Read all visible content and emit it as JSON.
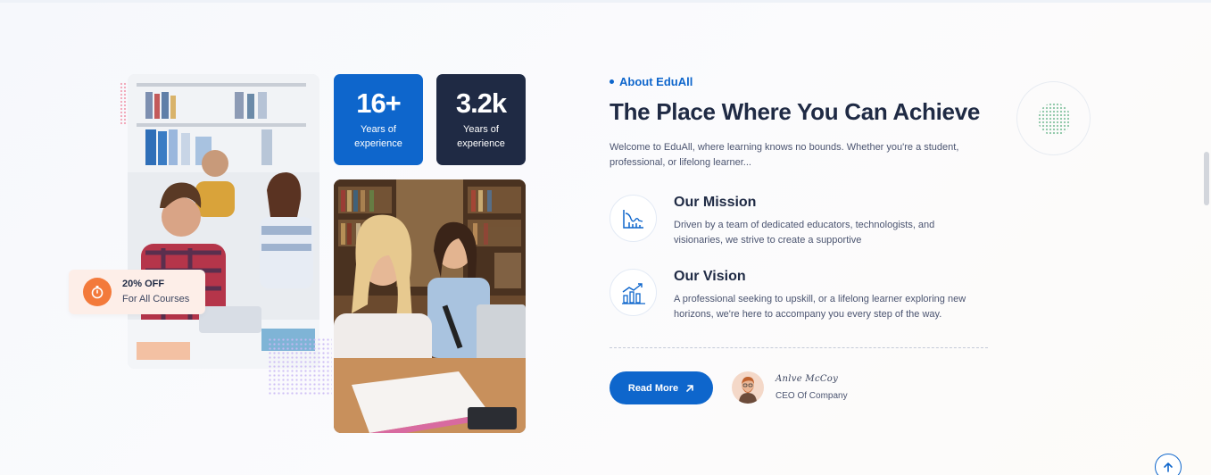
{
  "stats": [
    {
      "value": "16+",
      "label": "Years of experience"
    },
    {
      "value": "3.2k",
      "label": "Years of experience"
    }
  ],
  "promo": {
    "title": "20% OFF",
    "subtitle": "For All Courses",
    "icon": "stopwatch-icon"
  },
  "about": {
    "eyebrow": "About EduAll",
    "headline": "The Place Where You Can Achieve",
    "intro": "Welcome to EduAll, where learning knows no bounds. Whether you're a student, professional, or lifelong learner...",
    "features": [
      {
        "title": "Our Mission",
        "description": "Driven by a team of dedicated educators, technologists, and visionaries, we strive to create a supportive",
        "icon": "chart-icon"
      },
      {
        "title": "Our Vision",
        "description": "A professional seeking to upskill, or a lifelong learner exploring new horizons, we're here to accompany you every step of the way.",
        "icon": "growth-chart-icon"
      }
    ],
    "read_more_label": "Read More",
    "ceo": {
      "signature": "Anlve McCoy",
      "role": "CEO Of Company"
    }
  },
  "colors": {
    "primary": "#0e66cc",
    "dark": "#1f2a44",
    "accent": "#f37a3b"
  }
}
